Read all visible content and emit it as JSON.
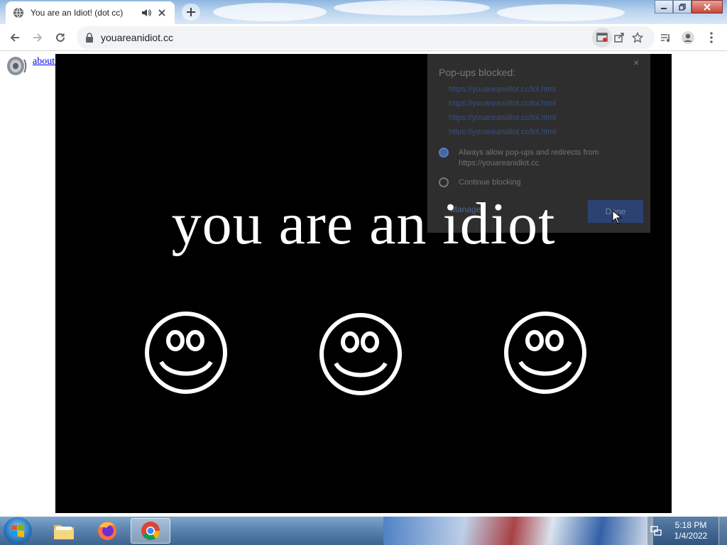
{
  "browser": {
    "tab_title": "You are an Idiot! (dot cc)",
    "url": "youareanidiot.cc"
  },
  "page": {
    "about_link": "about this",
    "headline": "you are an idiot"
  },
  "popup_bubble": {
    "title": "Pop-ups blocked:",
    "links": [
      "https://youareanidiot.cc/lol.html",
      "https://youareanidiot.cc/lol.html",
      "https://youareanidiot.cc/lol.html",
      "https://youareanidiot.cc/lol.html"
    ],
    "option_allow": "Always allow pop-ups and redirects from https://youareanidiot.cc",
    "option_block": "Continue blocking",
    "manage": "Manage",
    "done": "Done"
  },
  "taskbar": {
    "time": "5:18 PM",
    "date": "1/4/2022",
    "apps": [
      "windows-explorer",
      "firefox",
      "chrome"
    ]
  },
  "colors": {
    "stage_bg": "#000000",
    "text_white": "#ffffff",
    "link_blue": "#0000ee"
  }
}
